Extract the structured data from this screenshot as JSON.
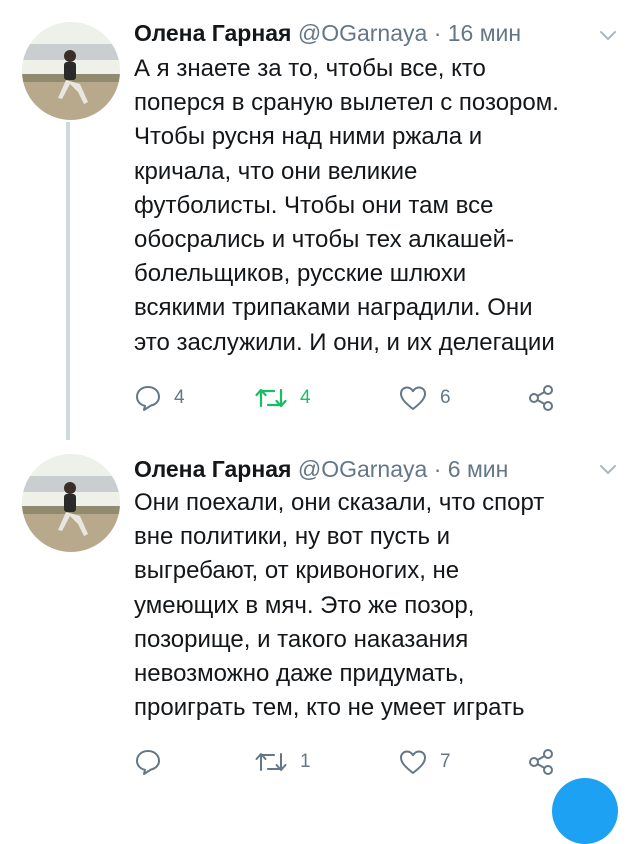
{
  "colors": {
    "accent": "#1da1f2",
    "retweet_active": "#17bf63",
    "secondary_text": "#657786",
    "thread_line": "#cfd9de"
  },
  "tweets": [
    {
      "author_name": "Олена Гарная",
      "handle": "@OGarnaya",
      "separator": "·",
      "time": "16 мин",
      "text": "А я знаете за то, чтобы все, кто\nпоперся в сраную вылетел с позором.\nЧтобы русня над ними ржала и\nкричала, что они великие\nфутболисты. Чтобы они там все\nобосрались и чтобы тех алкашей-\nболельщиков, русские шлюхи\nвсякими трипаками наградили. Они\nэто заслужили. И они, и их делегации",
      "replies": "4",
      "retweets": "4",
      "likes": "6",
      "retweet_active": true,
      "icons": [
        "reply-icon",
        "retweet-icon",
        "like-icon",
        "share-icon",
        "chevron-down-icon"
      ]
    },
    {
      "author_name": "Олена Гарная",
      "handle": "@OGarnaya",
      "separator": "·",
      "time": "6 мин",
      "text": "Они поехали, они сказали, что спорт\nвне политики, ну вот пусть и\nвыгребают, от кривоногих, не\nумеющих в мяч. Это же позор,\nпозорище, и такого наказания\nневозможно даже придумать,\nпроиграть тем, кто не умеет играть",
      "replies": "",
      "retweets": "1",
      "likes": "7",
      "retweet_active": false,
      "icons": [
        "reply-icon",
        "retweet-icon",
        "like-icon",
        "share-icon",
        "chevron-down-icon"
      ]
    }
  ]
}
